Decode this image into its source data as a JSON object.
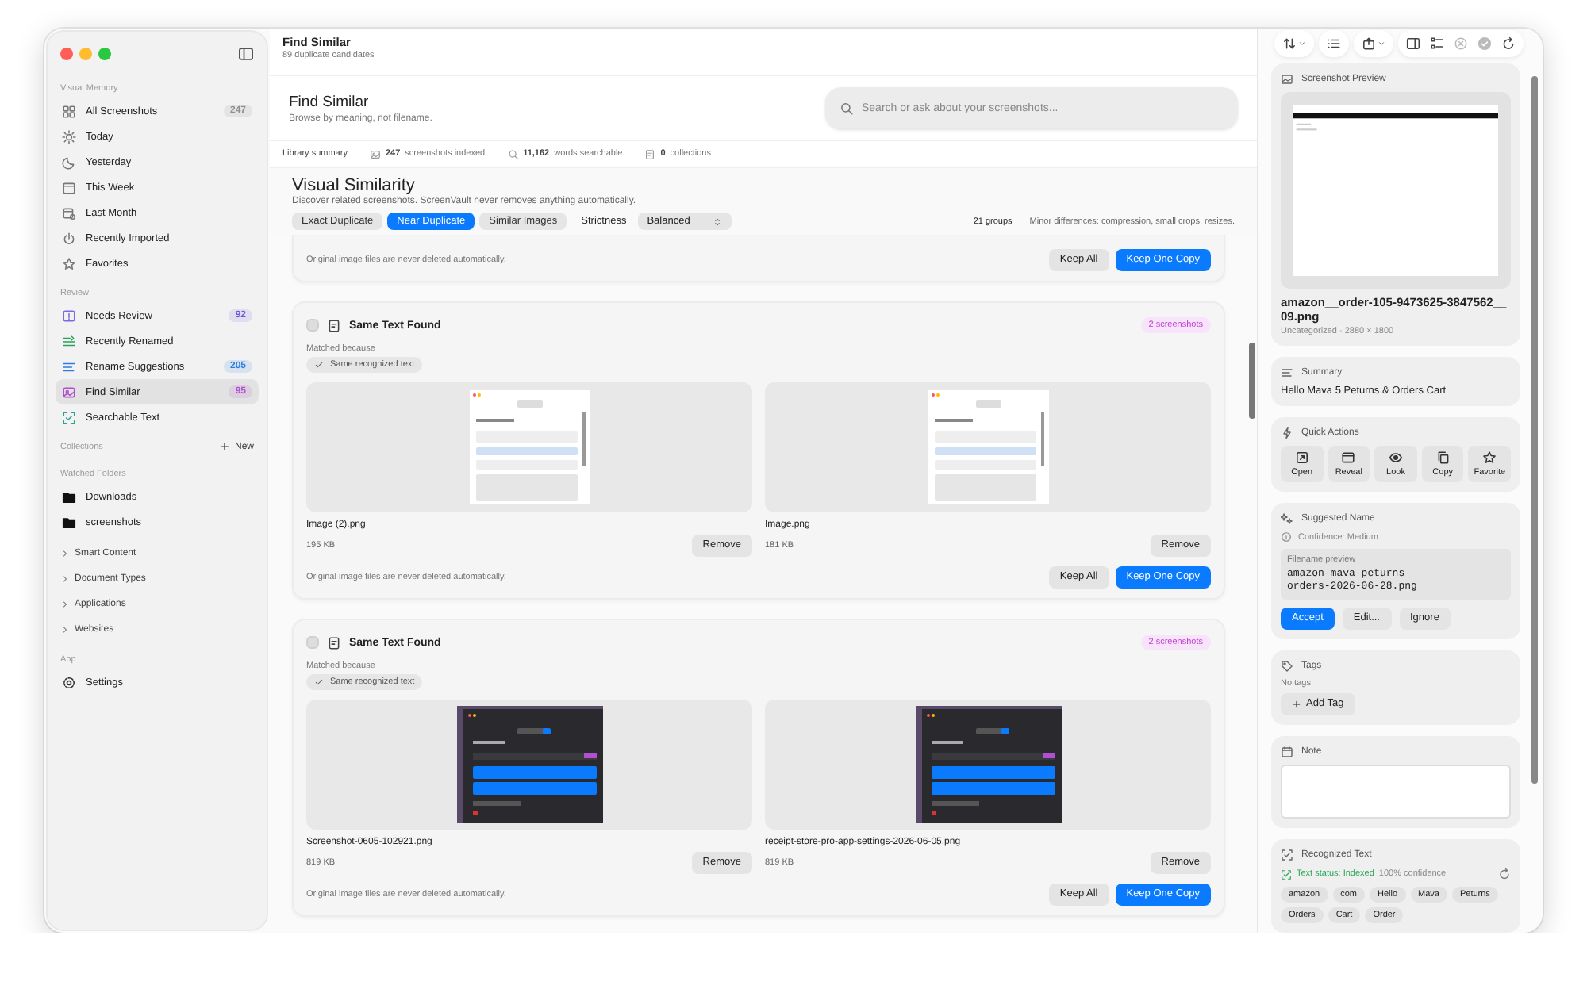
{
  "sidebar": {
    "sections": [
      {
        "kind": "list",
        "title": "Visual Memory",
        "items": [
          {
            "label": "All Screenshots",
            "badge": "247",
            "color": "#8e8e93",
            "selected": false
          },
          {
            "label": "Today",
            "selected": false
          },
          {
            "label": "Yesterday",
            "selected": false
          },
          {
            "label": "This Week",
            "selected": false
          },
          {
            "label": "Last Month",
            "selected": false
          },
          {
            "label": "Recently Imported",
            "selected": false
          },
          {
            "label": "Favorites",
            "selected": false
          }
        ]
      },
      {
        "kind": "list",
        "title": "Review",
        "items": [
          {
            "label": "Needs Review",
            "badge": "92",
            "color": "#6a5ad8",
            "selected": false
          },
          {
            "label": "Recently Renamed",
            "selected": false
          },
          {
            "label": "Rename Suggestions",
            "badge": "205",
            "color": "#2f7de1",
            "selected": false
          },
          {
            "label": "Find Similar",
            "badge": "95",
            "color": "#b04fd0",
            "selected": true
          },
          {
            "label": "Searchable Text",
            "selected": false
          }
        ]
      },
      {
        "kind": "list",
        "title": "Collections",
        "action": "New"
      },
      {
        "kind": "list",
        "title": "Watched Folders",
        "items": [
          {
            "label": "Downloads",
            "selected": false
          },
          {
            "label": "screenshots",
            "selected": false
          }
        ]
      },
      {
        "kind": "collapsed",
        "groups": [
          {
            "label": "Smart Content",
            "expanded": false
          },
          {
            "label": "Document Types",
            "expanded": false
          },
          {
            "label": "Applications",
            "expanded": false
          },
          {
            "label": "Websites",
            "expanded": false
          }
        ]
      },
      {
        "kind": "list",
        "title": "App",
        "items": [
          {
            "label": "Settings",
            "selected": false
          }
        ]
      }
    ]
  },
  "header": {
    "title": "Find Similar",
    "subtitle": "89 duplicate candidates"
  },
  "hero": {
    "title": "Find Similar",
    "subtitle": "Browse by meaning, not filename.",
    "search": {
      "placeholder": "Search or ask about your screenshots..."
    }
  },
  "summary": {
    "label": "Library summary",
    "stats": [
      {
        "value": "247",
        "label": "screenshots indexed"
      },
      {
        "value": "11,162",
        "label": "words searchable"
      },
      {
        "value": "0",
        "label": "collections"
      }
    ]
  },
  "similarity": {
    "title": "Visual Similarity",
    "description": "Discover related screenshots. ScreenVault never removes anything automatically.",
    "modes": [
      {
        "label": "Exact Duplicate",
        "selected": false
      },
      {
        "label": "Near Duplicate",
        "selected": true
      },
      {
        "label": "Similar Images",
        "selected": false
      }
    ],
    "strictness": {
      "label": "Strictness",
      "value": "Balanced"
    },
    "group_count": "21 groups",
    "hint": "Minor differences: compression, small crops, resizes."
  },
  "groups": [
    {
      "note": "Original image files are never deleted automatically.",
      "actions": [
        {
          "label": "Keep All",
          "kind": "secondary"
        },
        {
          "label": "Keep One Copy",
          "kind": "primary"
        }
      ]
    },
    {
      "checked": false,
      "title": "Same Text Found",
      "badge": "2 screenshots",
      "matched_label": "Matched because",
      "reasons": [
        "Same recognized text"
      ],
      "items": [
        {
          "name": "Image (2).png",
          "size": "195 KB",
          "kind": "light",
          "action": "Remove"
        },
        {
          "name": "Image.png",
          "size": "181 KB",
          "kind": "light",
          "action": "Remove"
        }
      ],
      "note": "Original image files are never deleted automatically.",
      "actions": [
        {
          "label": "Keep All",
          "kind": "secondary"
        },
        {
          "label": "Keep One Copy",
          "kind": "primary"
        }
      ]
    },
    {
      "checked": false,
      "title": "Same Text Found",
      "badge": "2 screenshots",
      "matched_label": "Matched because",
      "reasons": [
        "Same recognized text"
      ],
      "items": [
        {
          "name": "Screenshot-0605-102921.png",
          "size": "819 KB",
          "kind": "dark",
          "action": "Remove"
        },
        {
          "name": "receipt-store-pro-app-settings-2026-06-05.png",
          "size": "819 KB",
          "kind": "dark",
          "action": "Remove"
        }
      ],
      "note": "Original image files are never deleted automatically.",
      "actions": [
        {
          "label": "Keep All",
          "kind": "secondary"
        },
        {
          "label": "Keep One Copy",
          "kind": "primary"
        }
      ]
    }
  ],
  "inspector": {
    "toolbar": [
      {
        "disabled": false
      },
      {
        "disabled": false
      },
      {
        "disabled": false
      },
      {
        "disabled": false
      },
      {
        "disabled": false
      },
      {
        "disabled": true
      },
      {
        "disabled": true
      },
      {
        "disabled": false
      }
    ],
    "preview": {
      "title": "Screenshot Preview",
      "filename": "amazon__order-105-9473625-3847562__09.png",
      "meta": "Uncategorized · 2880 × 1800"
    },
    "summary": {
      "title": "Summary",
      "text": "Hello Mava 5 Peturns & Orders Cart"
    },
    "quick_actions": {
      "title": "Quick Actions",
      "actions": [
        "Open",
        "Reveal",
        "Look",
        "Copy",
        "Favorite"
      ]
    },
    "suggested_name": {
      "title": "Suggested Name",
      "confidence": "Confidence: Medium",
      "preview_label": "Filename preview",
      "filename": "amazon-mava-peturns-orders-2026-06-28.png",
      "actions": [
        {
          "label": "Accept",
          "kind": "primary"
        },
        {
          "label": "Edit...",
          "kind": "secondary"
        },
        {
          "label": "Ignore",
          "kind": "secondary"
        }
      ]
    },
    "tags": {
      "title": "Tags",
      "empty": "No tags",
      "add": "Add Tag"
    },
    "note": {
      "title": "Note"
    },
    "recognized_text": {
      "title": "Recognized Text",
      "status": "Text status: Indexed",
      "confidence": "100% confidence",
      "words": [
        "amazon",
        "com",
        "Hello",
        "Mava",
        "Peturns",
        "Orders",
        "Cart",
        "Order"
      ]
    }
  }
}
